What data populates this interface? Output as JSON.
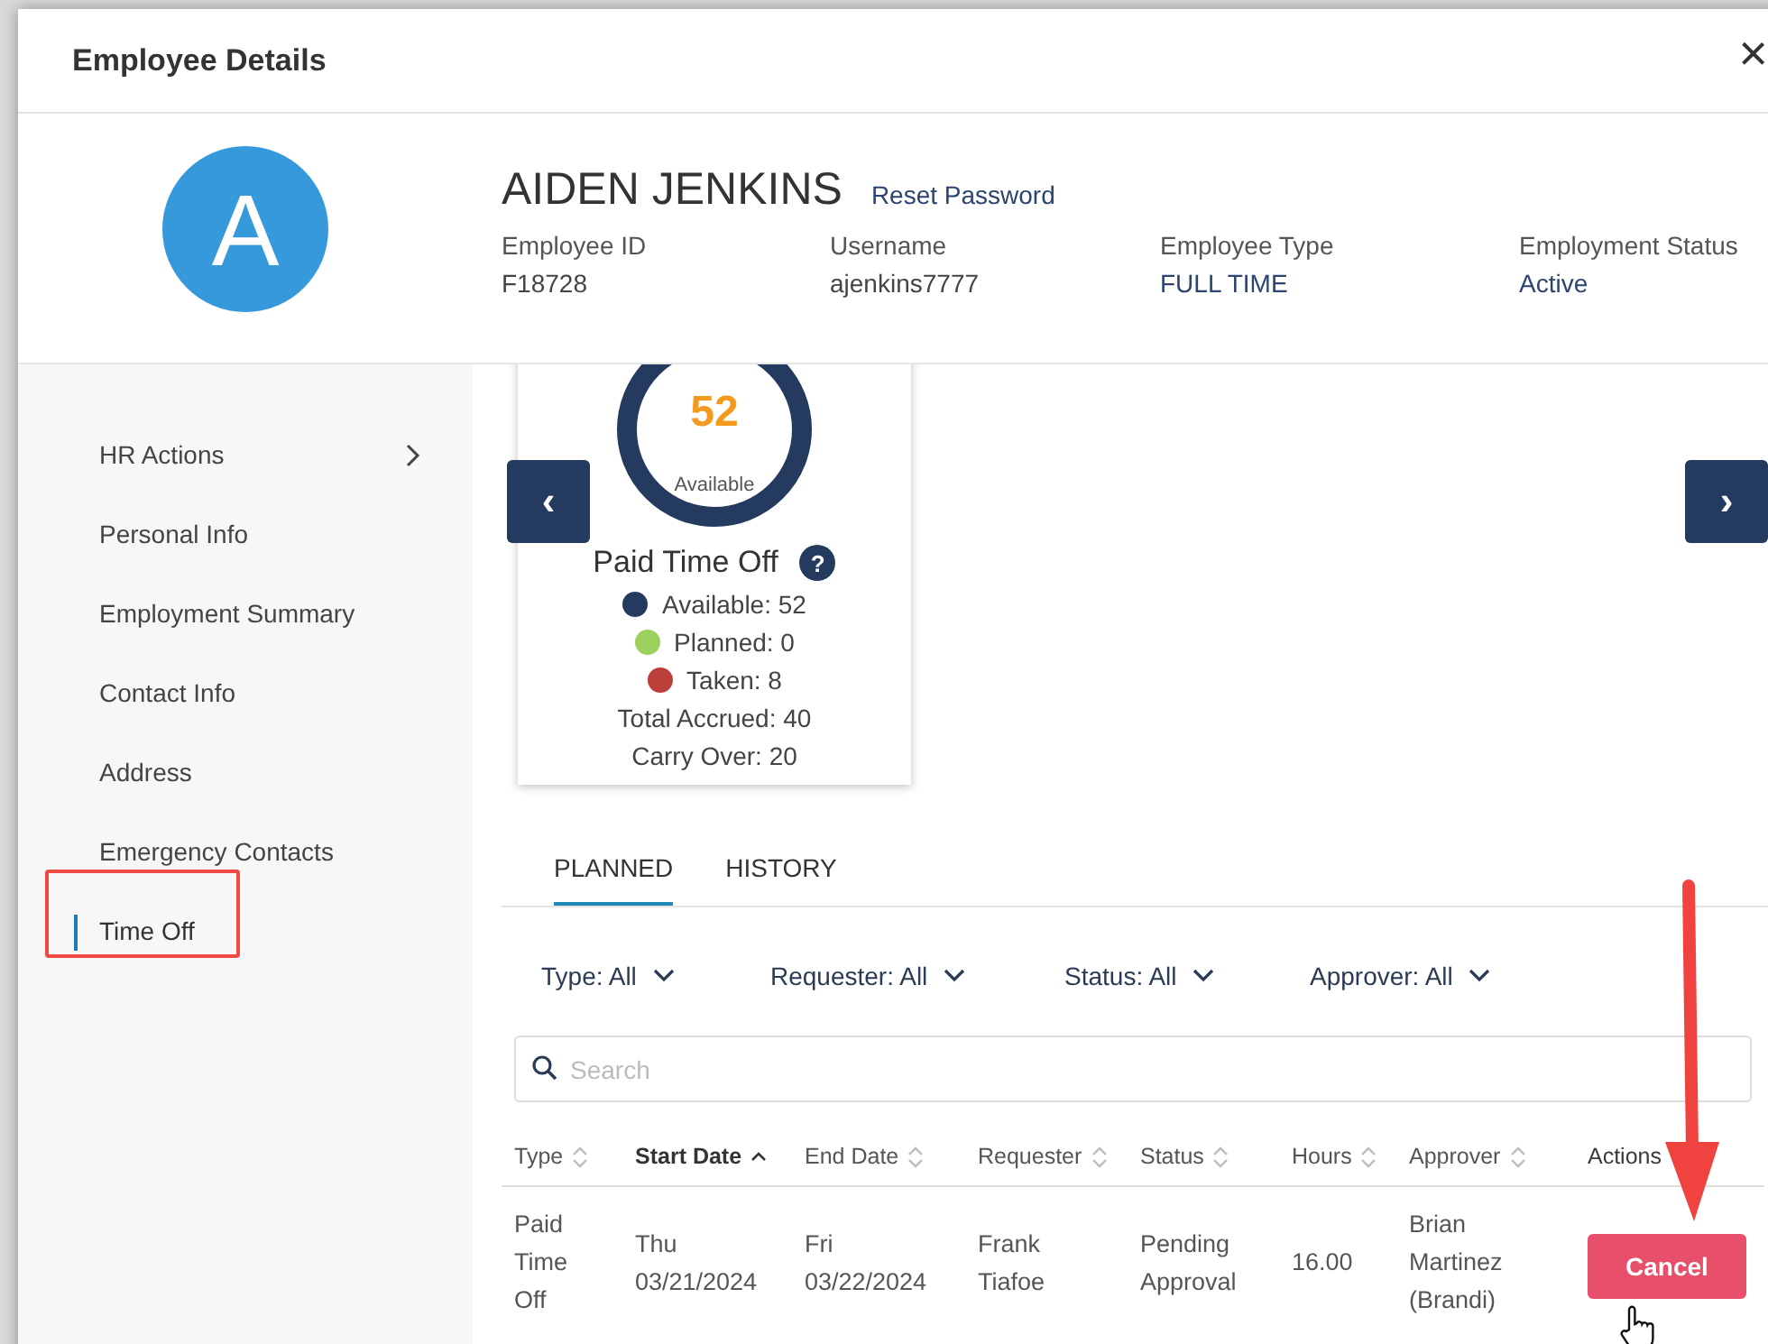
{
  "window": {
    "title": "Employee Details",
    "close": "×"
  },
  "profile": {
    "initial": "A",
    "name": "AIDEN JENKINS",
    "reset_link": "Reset Password",
    "fields": [
      {
        "label": "Employee ID",
        "value": "F18728",
        "kind": "plain"
      },
      {
        "label": "Username",
        "value": "ajenkins7777",
        "kind": "plain"
      },
      {
        "label": "Employee Type",
        "value": "FULL TIME",
        "kind": "accent"
      },
      {
        "label": "Employment Status",
        "value": "Active",
        "kind": "accent"
      }
    ]
  },
  "sidebar": {
    "items": [
      {
        "label": "HR Actions",
        "has_submenu": true,
        "selected": false
      },
      {
        "label": "Personal Info",
        "has_submenu": false,
        "selected": false
      },
      {
        "label": "Employment Summary",
        "has_submenu": false,
        "selected": false
      },
      {
        "label": "Contact Info",
        "has_submenu": false,
        "selected": false
      },
      {
        "label": "Address",
        "has_submenu": false,
        "selected": false
      },
      {
        "label": "Emergency Contacts",
        "has_submenu": false,
        "selected": false
      },
      {
        "label": "Time Off",
        "has_submenu": false,
        "selected": true
      }
    ]
  },
  "balance_card": {
    "total": "52",
    "total_caption": "Available",
    "title": "Paid Time Off",
    "help": "?",
    "legend": [
      {
        "label": "Available: 52",
        "color": "#243a5e"
      },
      {
        "label": "Planned: 0",
        "color": "#9bd15a"
      },
      {
        "label": "Taken: 8",
        "color": "#bd3f3a"
      }
    ],
    "totals": [
      "Total Accrued: 40",
      "Carry Over: 20"
    ],
    "prev": "‹",
    "next": "›"
  },
  "tabs": [
    {
      "label": "PLANNED",
      "selected": true
    },
    {
      "label": "HISTORY",
      "selected": false
    }
  ],
  "filters": [
    "Type: All",
    "Requester: All",
    "Status: All",
    "Approver: All"
  ],
  "search": {
    "placeholder": "Search"
  },
  "table": {
    "columns": [
      {
        "label": "Type",
        "sortable": true,
        "sorted": false
      },
      {
        "label": "Start Date",
        "sortable": true,
        "sorted": true
      },
      {
        "label": "End Date",
        "sortable": true,
        "sorted": false
      },
      {
        "label": "Requester",
        "sortable": true,
        "sorted": false
      },
      {
        "label": "Status",
        "sortable": true,
        "sorted": false
      },
      {
        "label": "Hours",
        "sortable": true,
        "sorted": false
      },
      {
        "label": "Approver",
        "sortable": true,
        "sorted": false
      },
      {
        "label": "Actions",
        "sortable": false,
        "sorted": false
      }
    ],
    "rows": [
      {
        "cells": [
          "Paid Time Off",
          "Thu 03/21/2024",
          "Fri 03/22/2024",
          "Frank Tiafoe",
          "Pending Approval",
          "16.00",
          "Brian Martinez (Brandi)"
        ],
        "action": "Cancel"
      }
    ]
  }
}
